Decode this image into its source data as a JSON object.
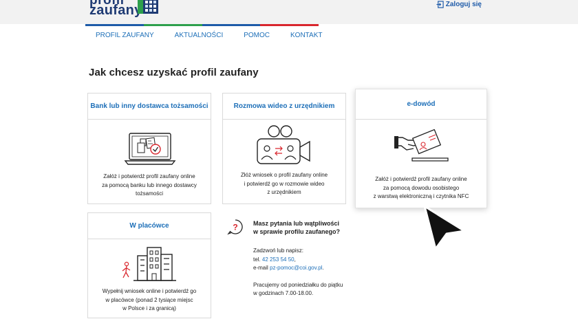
{
  "header": {
    "logo_line1": "profil",
    "logo_line2": "zaufany",
    "login_label": "Zaloguj się"
  },
  "nav": {
    "items": [
      {
        "label": "PROFIL ZAUFANY"
      },
      {
        "label": "AKTUALNOŚCI"
      },
      {
        "label": "POMOC"
      },
      {
        "label": "KONTAKT"
      }
    ],
    "bar_colors": [
      "#1d5aa8",
      "#2d9f4c",
      "#1d5aa8",
      "#d9262d"
    ]
  },
  "main": {
    "title": "Jak chcesz uzyskać profil zaufany"
  },
  "cards": {
    "bank": {
      "title": "Bank lub inny dostawca tożsamości",
      "desc": [
        "Załóż i potwierdź profil zaufany online",
        "za pomocą banku lub innego dostawcy",
        "tożsamości"
      ]
    },
    "video": {
      "title": "Rozmowa wideo z urzędnikiem",
      "desc": [
        "Złóż wniosek o profil zaufany online",
        "i potwierdź go w rozmowie wideo",
        "z urzędnikiem"
      ]
    },
    "edowod": {
      "title": "e-dowód",
      "desc": [
        "Załóż i potwierdź profil zaufany online",
        "za pomocą dowodu osobistego",
        "z warstwą elektroniczną i czytnika NFC"
      ]
    },
    "placowka": {
      "title": "W placówce",
      "desc": [
        "Wypełnij wniosek online i potwierdź go",
        "w placówce (ponad 2 tysiące miejsc",
        "w Polsce i za granicą)"
      ]
    }
  },
  "help": {
    "title_line1": "Masz pytania lub wątpliwości",
    "title_line2": "w sprawie profilu zaufanego?",
    "contact_intro": "Zadzwoń lub napisz:",
    "phone_prefix": "tel. ",
    "phone": "42 253 54 50",
    "phone_suffix": ",",
    "email_prefix": "e-mail ",
    "email": "pz-pomoc@coi.gov.pl",
    "email_suffix": ".",
    "hours_line1": "Pracujemy od poniedziałku do piątku",
    "hours_line2": "w godzinach 7.00-18.00."
  },
  "colors": {
    "accent": "#1d6fb8",
    "brand_navy": "#1f3b74",
    "red": "#d9262d",
    "green": "#2d9f4c"
  },
  "icons": {
    "login": "login-icon",
    "help": "question-icon",
    "cursor": "mouse-cursor-icon"
  }
}
